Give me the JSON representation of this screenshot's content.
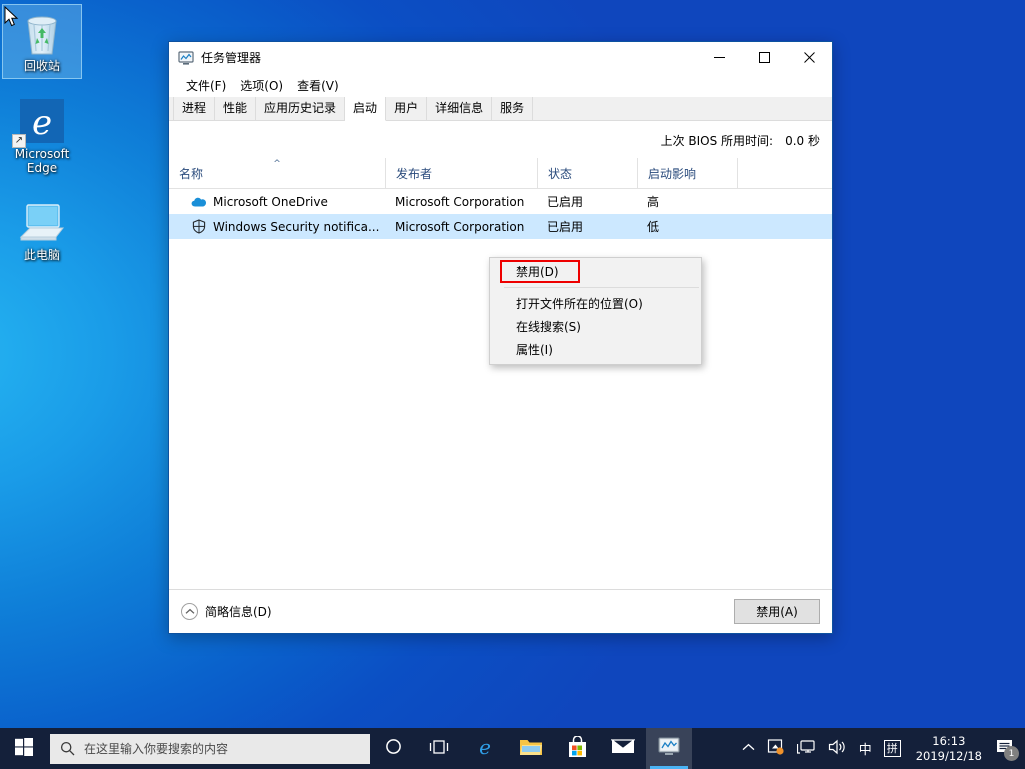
{
  "desktop": {
    "icons": [
      {
        "label": "回收站",
        "icon": "recycle-bin-icon",
        "selected": true
      },
      {
        "label": "Microsoft Edge",
        "icon": "edge-icon",
        "selected": false
      },
      {
        "label": "此电脑",
        "icon": "this-pc-icon",
        "selected": false
      }
    ]
  },
  "window": {
    "title": "任务管理器",
    "icon": "task-manager-icon",
    "controls": {
      "minimize": "—",
      "maximize": "☐",
      "close": "✕"
    },
    "menu": [
      "文件(F)",
      "选项(O)",
      "查看(V)"
    ],
    "tabs": [
      {
        "label": "进程",
        "active": false
      },
      {
        "label": "性能",
        "active": false
      },
      {
        "label": "应用历史记录",
        "active": false
      },
      {
        "label": "启动",
        "active": true
      },
      {
        "label": "用户",
        "active": false
      },
      {
        "label": "详细信息",
        "active": false
      },
      {
        "label": "服务",
        "active": false
      }
    ],
    "bios": {
      "label": "上次 BIOS 所用时间:",
      "value": "0.0 秒"
    },
    "columns": [
      {
        "label": "名称",
        "sort": "asc"
      },
      {
        "label": "发布者",
        "sort": ""
      },
      {
        "label": "状态",
        "sort": ""
      },
      {
        "label": "启动影响",
        "sort": ""
      },
      {
        "label": "",
        "sort": ""
      }
    ],
    "rows": [
      {
        "icon": "onedrive-icon",
        "name": "Microsoft OneDrive",
        "publisher": "Microsoft Corporation",
        "status": "已启用",
        "impact": "高",
        "selected": false
      },
      {
        "icon": "shield-icon",
        "name": "Windows Security notifica...",
        "publisher": "Microsoft Corporation",
        "status": "已启用",
        "impact": "低",
        "selected": true
      }
    ],
    "footer": {
      "fewer_details": "简略信息(D)",
      "disable_button": "禁用(A)"
    }
  },
  "context_menu": {
    "items": [
      {
        "label": "禁用(D)",
        "highlighted": true,
        "separator_after": true
      },
      {
        "label": "打开文件所在的位置(O)",
        "highlighted": false,
        "separator_after": false
      },
      {
        "label": "在线搜索(S)",
        "highlighted": false,
        "separator_after": false
      },
      {
        "label": "属性(I)",
        "highlighted": false,
        "separator_after": false
      }
    ],
    "highlight_color": "#ee0000"
  },
  "taskbar": {
    "start": "start-icon",
    "search": {
      "placeholder": "在这里输入你要搜索的内容",
      "icon": "search-icon"
    },
    "buttons": [
      {
        "name": "cortana-button",
        "icon": "cortana-icon",
        "active": false
      },
      {
        "name": "task-view-button",
        "icon": "task-view-icon",
        "active": false
      },
      {
        "name": "edge-button",
        "icon": "edge-icon",
        "active": false
      },
      {
        "name": "file-explorer-button",
        "icon": "folder-icon",
        "active": false
      },
      {
        "name": "store-button",
        "icon": "store-icon",
        "active": false
      },
      {
        "name": "mail-button",
        "icon": "mail-icon",
        "active": false
      },
      {
        "name": "task-manager-button",
        "icon": "task-manager-icon",
        "active": true
      }
    ],
    "tray": {
      "chevron": "^",
      "onedrive": "onedrive-tray-icon",
      "network": "network-icon",
      "volume": "volume-icon",
      "ime_lang": "中",
      "ime_mode": "拼"
    },
    "clock": {
      "time": "16:13",
      "date": "2019/12/18"
    },
    "notifications": {
      "icon": "notification-icon",
      "count": "1"
    }
  }
}
